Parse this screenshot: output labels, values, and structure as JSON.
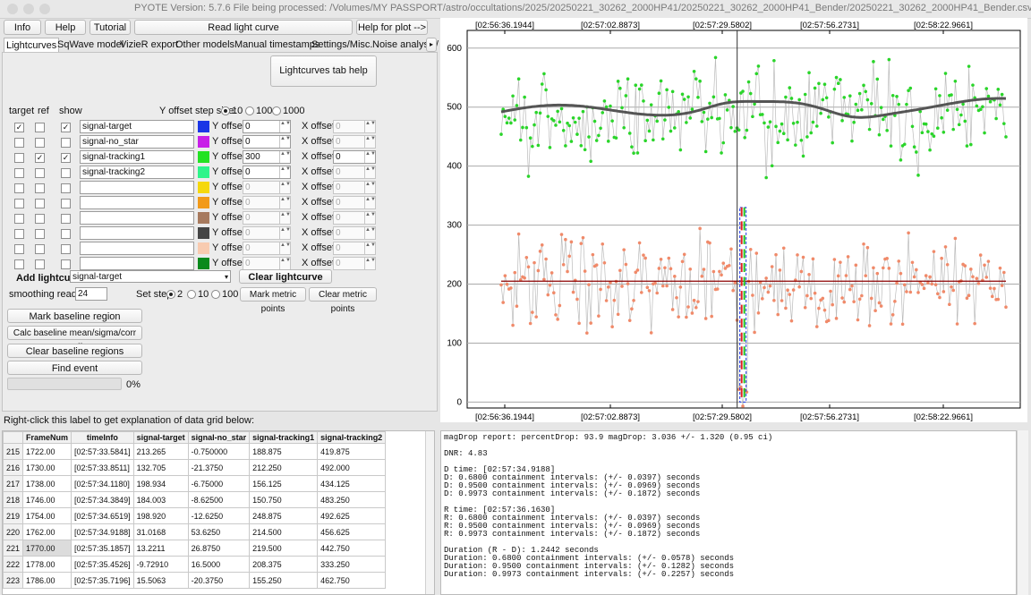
{
  "window": {
    "title": "PYOTE Version: 5.7.6  File being processed: /Volumes/MY PASSPORT/astro/occultations/2025/20250221_30262_2000HP41/20250221_30262_2000HP41_Bender/20250221_30262_2000HP41_Bender.csv"
  },
  "topbar": {
    "info": "Info",
    "help": "Help",
    "tutorial": "Tutorial",
    "read": "Read light curve",
    "helpplot": "Help for plot -->"
  },
  "tabs": [
    "Lightcurves",
    "SqWave model",
    "VizieR export",
    "Other models",
    "Manual timestamps",
    "Settings/Misc.",
    "Noise analysis/"
  ],
  "panel": {
    "tab_help": "Lightcurves tab help",
    "col_target": "target",
    "col_ref": "ref",
    "col_show": "show",
    "yoffset_step_label": "Y offset step size:",
    "step_opts": [
      "10",
      "100",
      "1000"
    ],
    "y_offset_label": "Y offset:",
    "x_offset_label": "X offset:",
    "rows": [
      {
        "name": "signal-target",
        "color": "#1a35e6",
        "yoff": "0",
        "xoff": "0",
        "target": true,
        "ref": false,
        "show": true,
        "enabled": true
      },
      {
        "name": "signal-no_star",
        "color": "#c81ee8",
        "yoff": "0",
        "xoff": "0",
        "target": false,
        "ref": false,
        "show": false,
        "enabled": true
      },
      {
        "name": "signal-tracking1",
        "color": "#23e223",
        "yoff": "300",
        "xoff": "0",
        "target": false,
        "ref": true,
        "show": true,
        "enabled": true
      },
      {
        "name": "signal-tracking2",
        "color": "#2df58a",
        "yoff": "0",
        "xoff": "0",
        "target": false,
        "ref": false,
        "show": false,
        "enabled": true
      },
      {
        "name": "",
        "color": "#f5d80d",
        "yoff": "0",
        "xoff": "0",
        "target": false,
        "ref": false,
        "show": false,
        "enabled": false
      },
      {
        "name": "",
        "color": "#f29a19",
        "yoff": "0",
        "xoff": "0",
        "target": false,
        "ref": false,
        "show": false,
        "enabled": false
      },
      {
        "name": "",
        "color": "#a77a5e",
        "yoff": "0",
        "xoff": "0",
        "target": false,
        "ref": false,
        "show": false,
        "enabled": false
      },
      {
        "name": "",
        "color": "#454545",
        "yoff": "0",
        "xoff": "0",
        "target": false,
        "ref": false,
        "show": false,
        "enabled": false
      },
      {
        "name": "",
        "color": "#f8cbb0",
        "yoff": "0",
        "xoff": "0",
        "target": false,
        "ref": false,
        "show": false,
        "enabled": false
      },
      {
        "name": "",
        "color": "#0a8a1c",
        "yoff": "0",
        "xoff": "0",
        "target": false,
        "ref": false,
        "show": false,
        "enabled": false
      }
    ],
    "add_label": "Add lightcurve",
    "add_value": "signal-target",
    "clear_list": "Clear lightcurve list",
    "smoothing_label": "smoothing readings",
    "smoothing_value": "24",
    "setstep_label": "Set step:",
    "setstep_opts": [
      "2",
      "10",
      "100"
    ],
    "mark_metric": "Mark metric points",
    "clear_metric": "Clear metric points",
    "mark_baseline": "Mark baseline region",
    "calc_baseline": "Calc baseline mean/sigma/corr coeffs",
    "clear_baseline": "Clear baseline regions",
    "find_event": "Find event",
    "progress": "0%"
  },
  "grid_label": "Right-click this label to get explanation of data grid below:",
  "plot": {
    "time_labels": [
      "[02:56:36.1944]",
      "[02:57:02.8873]",
      "[02:57:29.5802]",
      "[02:57:56.2731]",
      "[02:58:22.9661]"
    ],
    "y_ticks": [
      0,
      100,
      200,
      300,
      400,
      500,
      600
    ]
  },
  "table": {
    "headers": [
      "FrameNum",
      "timeInfo",
      "signal-target",
      "signal-no_star",
      "signal-tracking1",
      "signal-tracking2"
    ],
    "rows": [
      [
        "215",
        "1722.00",
        "[02:57:33.5841]",
        "213.265",
        "-0.750000",
        "188.875",
        "419.875"
      ],
      [
        "216",
        "1730.00",
        "[02:57:33.8511]",
        "132.705",
        "-21.3750",
        "212.250",
        "492.000"
      ],
      [
        "217",
        "1738.00",
        "[02:57:34.1180]",
        "198.934",
        "-6.75000",
        "156.125",
        "434.125"
      ],
      [
        "218",
        "1746.00",
        "[02:57:34.3849]",
        "184.003",
        "-8.62500",
        "150.750",
        "483.250"
      ],
      [
        "219",
        "1754.00",
        "[02:57:34.6519]",
        "198.920",
        "-12.6250",
        "248.875",
        "492.625"
      ],
      [
        "220",
        "1762.00",
        "[02:57:34.9188]",
        "31.0168",
        "53.6250",
        "214.500",
        "456.625"
      ],
      [
        "221",
        "1770.00",
        "[02:57:35.1857]",
        "13.2211",
        "26.8750",
        "219.500",
        "442.750"
      ],
      [
        "222",
        "1778.00",
        "[02:57:35.4526]",
        "-9.72910",
        "16.5000",
        "208.375",
        "333.250"
      ],
      [
        "223",
        "1786.00",
        "[02:57:35.7196]",
        "15.5063",
        "-20.3750",
        "155.250",
        "462.750"
      ]
    ]
  },
  "report_lines": [
    "magDrop report: percentDrop: 93.9 magDrop: 3.036 +/- 1.320 (0.95 ci)",
    "",
    "DNR: 4.83",
    "",
    "D time: [02:57:34.9188]",
    "D: 0.6800 containment intervals: (+/- 0.0397) seconds",
    "D: 0.9500 containment intervals: (+/- 0.0969) seconds",
    "D: 0.9973 containment intervals: (+/- 0.1872) seconds",
    "",
    "R time: [02:57:36.1630]",
    "R: 0.6800 containment intervals: (+/- 0.0397) seconds",
    "R: 0.9500 containment intervals: (+/- 0.0969) seconds",
    "R: 0.9973 containment intervals: (+/- 0.1872) seconds",
    "",
    "Duration (R - D): 1.2442 seconds",
    "Duration: 0.6800 containment intervals: (+/- 0.0578) seconds",
    "Duration: 0.9500 containment intervals: (+/- 0.1282) seconds",
    "Duration: 0.9973 containment intervals: (+/- 0.2257) seconds"
  ]
}
